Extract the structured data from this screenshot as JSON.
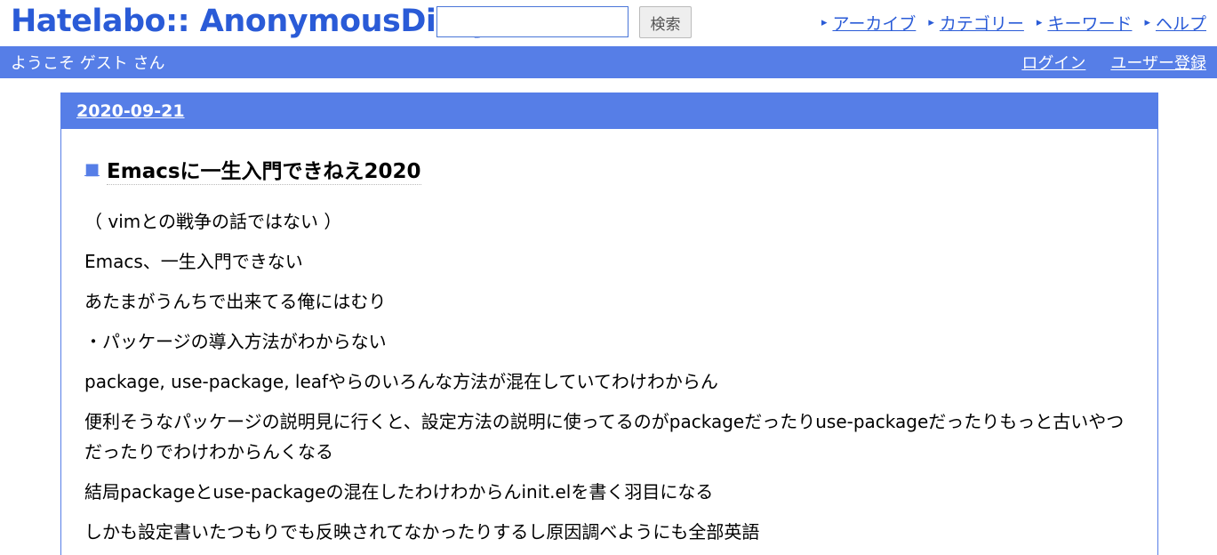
{
  "header": {
    "logo": "Hatelabo:: AnonymousDiary",
    "search": {
      "placeholder": "",
      "value": "",
      "button": "検索"
    },
    "nav": [
      {
        "label": "アーカイブ"
      },
      {
        "label": "カテゴリー"
      },
      {
        "label": "キーワード"
      },
      {
        "label": "ヘルプ"
      }
    ]
  },
  "bar": {
    "welcome": "ようこそ ゲスト さん",
    "login": "ログイン",
    "register": "ユーザー登録"
  },
  "day": {
    "date": "2020-09-21"
  },
  "entry": {
    "mark": "■",
    "title": "Emacsに一生入門できねえ2020",
    "paragraphs": [
      "（ vimとの戦争の話ではない ）",
      "Emacs、一生入門できない",
      "あたまがうんちで出来てる俺にはむり",
      "・パッケージの導入方法がわからない",
      "package, use-package, leafやらのいろんな方法が混在していてわけわからん",
      "便利そうなパッケージの説明見に行くと、設定方法の説明に使ってるのがpackageだったりuse-packageだったりもっと古いやつだったりでわけわからんくなる",
      "結局packageとuse-packageの混在したわけわからんinit.elを書く羽目になる",
      "しかも設定書いたつもりでも反映されてなかったりするし原因調べようにも全部英語"
    ]
  },
  "colors": {
    "brand": "#2a5bd7",
    "bar": "#567ee7"
  },
  "icons": {
    "nav_arrow": "chevron-right-icon",
    "title_mark": "square-bullet-icon"
  }
}
